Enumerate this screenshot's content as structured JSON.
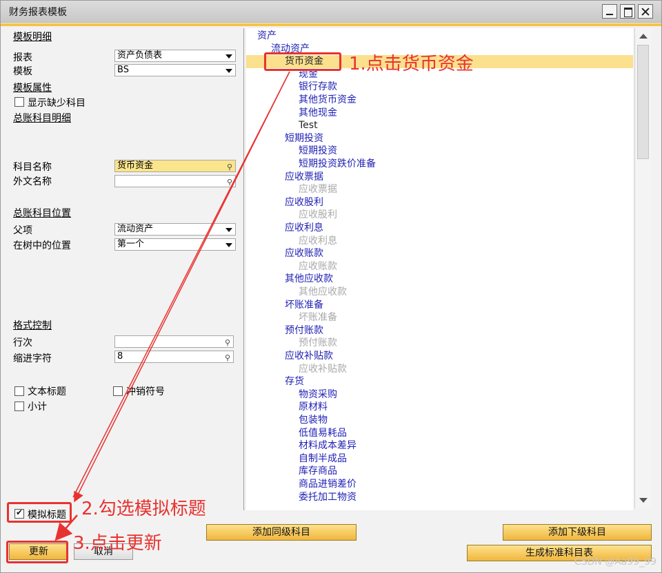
{
  "window": {
    "title": "财务报表模板"
  },
  "left": {
    "section_template_detail": "模板明细",
    "report_label": "报表",
    "report_value": "资产负债表",
    "template_label": "模板",
    "template_value": "BS",
    "section_template_props": "模板属性",
    "show_missing_label": "显示缺少科目",
    "section_gl_detail": "总账科目明细",
    "account_name_label": "科目名称",
    "account_name_value": "货币资金",
    "foreign_name_label": "外文名称",
    "foreign_name_value": "",
    "section_gl_position": "总账科目位置",
    "parent_label": "父项",
    "parent_value": "流动资产",
    "tree_pos_label": "在树中的位置",
    "tree_pos_value": "第一个",
    "section_format": "格式控制",
    "line_no_label": "行次",
    "line_no_value": "",
    "indent_label": "缩进字符",
    "indent_value": "8",
    "text_title_label": "文本标题",
    "offset_sign_label": "冲销符号",
    "subtotal_label": "小计",
    "dummy_title_label": "模拟标题"
  },
  "tree": {
    "rows": [
      {
        "text": "资产",
        "indent": 16,
        "color": "blue"
      },
      {
        "text": "流动资产",
        "indent": 36,
        "color": "blue"
      },
      {
        "text": "货币资金",
        "indent": 56,
        "color": "black",
        "selected": true
      },
      {
        "text": "现金",
        "indent": 76,
        "color": "blue"
      },
      {
        "text": "银行存款",
        "indent": 76,
        "color": "blue"
      },
      {
        "text": "其他货币资金",
        "indent": 76,
        "color": "blue"
      },
      {
        "text": "其他现金",
        "indent": 76,
        "color": "blue"
      },
      {
        "text": "Test",
        "indent": 76,
        "color": "black"
      },
      {
        "text": "短期投资",
        "indent": 56,
        "color": "blue"
      },
      {
        "text": "短期投资",
        "indent": 76,
        "color": "blue"
      },
      {
        "text": "短期投资跌价准备",
        "indent": 76,
        "color": "blue"
      },
      {
        "text": "应收票据",
        "indent": 56,
        "color": "blue"
      },
      {
        "text": "应收票据",
        "indent": 76,
        "color": "gray"
      },
      {
        "text": "应收股利",
        "indent": 56,
        "color": "blue"
      },
      {
        "text": "应收股利",
        "indent": 76,
        "color": "gray"
      },
      {
        "text": "应收利息",
        "indent": 56,
        "color": "blue"
      },
      {
        "text": "应收利息",
        "indent": 76,
        "color": "gray"
      },
      {
        "text": "应收账款",
        "indent": 56,
        "color": "blue"
      },
      {
        "text": "应收账款",
        "indent": 76,
        "color": "gray"
      },
      {
        "text": "其他应收款",
        "indent": 56,
        "color": "blue"
      },
      {
        "text": "其他应收款",
        "indent": 76,
        "color": "gray"
      },
      {
        "text": "坏账准备",
        "indent": 56,
        "color": "blue"
      },
      {
        "text": "坏账准备",
        "indent": 76,
        "color": "gray"
      },
      {
        "text": "预付账款",
        "indent": 56,
        "color": "blue"
      },
      {
        "text": "预付账款",
        "indent": 76,
        "color": "gray"
      },
      {
        "text": "应收补贴款",
        "indent": 56,
        "color": "blue"
      },
      {
        "text": "应收补贴款",
        "indent": 76,
        "color": "gray"
      },
      {
        "text": "存货",
        "indent": 56,
        "color": "blue"
      },
      {
        "text": "物资采购",
        "indent": 76,
        "color": "blue"
      },
      {
        "text": "原材料",
        "indent": 76,
        "color": "blue"
      },
      {
        "text": "包装物",
        "indent": 76,
        "color": "blue"
      },
      {
        "text": "低值易耗品",
        "indent": 76,
        "color": "blue"
      },
      {
        "text": "材料成本差异",
        "indent": 76,
        "color": "blue"
      },
      {
        "text": "自制半成品",
        "indent": 76,
        "color": "blue"
      },
      {
        "text": "库存商品",
        "indent": 76,
        "color": "blue"
      },
      {
        "text": "商品进销差价",
        "indent": 76,
        "color": "blue"
      },
      {
        "text": "委托加工物资",
        "indent": 76,
        "color": "blue"
      }
    ]
  },
  "buttons": {
    "add_same_level": "添加同级科目",
    "add_sub_level": "添加下级科目",
    "generate_standard": "生成标准科目表",
    "update": "更新",
    "cancel": "取消"
  },
  "annotations": {
    "step1": "1.点击货币资金",
    "step2": "2.勾选模拟标题",
    "step3": "3.点击更新"
  },
  "colors": {
    "annotation": "#e8322f",
    "selection": "#fbe08e",
    "tree_blue": "#1f1fb5",
    "accent": "#f6c344"
  },
  "watermark": "CSDN @Aa99_99"
}
